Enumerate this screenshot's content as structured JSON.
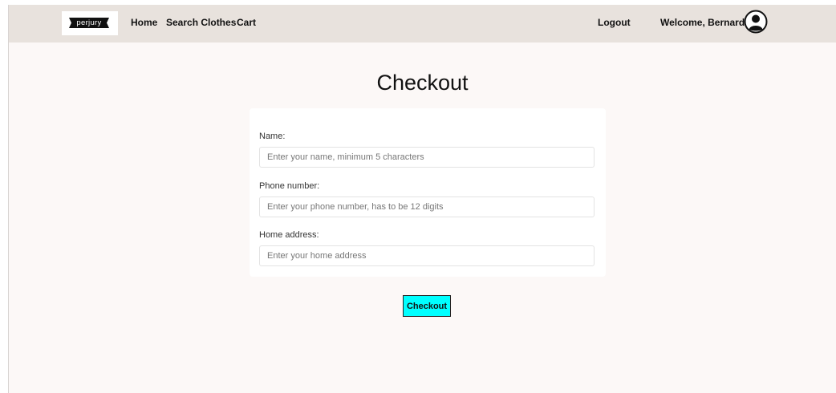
{
  "navbar": {
    "logo_text": "perjury",
    "links": [
      {
        "label": "Home"
      },
      {
        "label": "Search Clothes"
      },
      {
        "label": "Cart"
      }
    ],
    "logout_label": "Logout",
    "welcome_text": "Welcome, Bernard",
    "avatar_icon": "user-circle-icon",
    "background_color": "#e8e2dd"
  },
  "main": {
    "title": "Checkout",
    "form": {
      "fields": [
        {
          "label": "Name:",
          "placeholder": "Enter your name, minimum 5 characters",
          "value": ""
        },
        {
          "label": "Phone number:",
          "placeholder": "Enter your phone number, has to be 12 digits",
          "value": ""
        },
        {
          "label": "Home address:",
          "placeholder": "Enter your home address",
          "value": ""
        }
      ]
    },
    "submit_label": "Checkout",
    "submit_color": "#00ffff"
  },
  "page": {
    "background_color": "#fcf8f7"
  }
}
